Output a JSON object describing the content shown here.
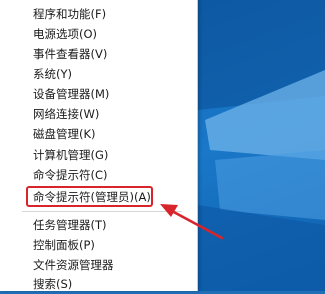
{
  "menu": {
    "items": [
      {
        "label": "程序和功能(F)"
      },
      {
        "label": "电源选项(O)"
      },
      {
        "label": "事件查看器(V)"
      },
      {
        "label": "系统(Y)"
      },
      {
        "label": "设备管理器(M)"
      },
      {
        "label": "网络连接(W)"
      },
      {
        "label": "磁盘管理(K)"
      },
      {
        "label": "计算机管理(G)"
      },
      {
        "label": "命令提示符(C)"
      },
      {
        "label": "命令提示符(管理员)(A)"
      },
      {
        "label": "任务管理器(T)"
      },
      {
        "label": "控制面板(P)"
      },
      {
        "label": "文件资源管理器"
      },
      {
        "label": "搜索(S)"
      }
    ]
  },
  "colors": {
    "annotation": "#d8242b",
    "desktop_blue": "#1a78c9"
  }
}
